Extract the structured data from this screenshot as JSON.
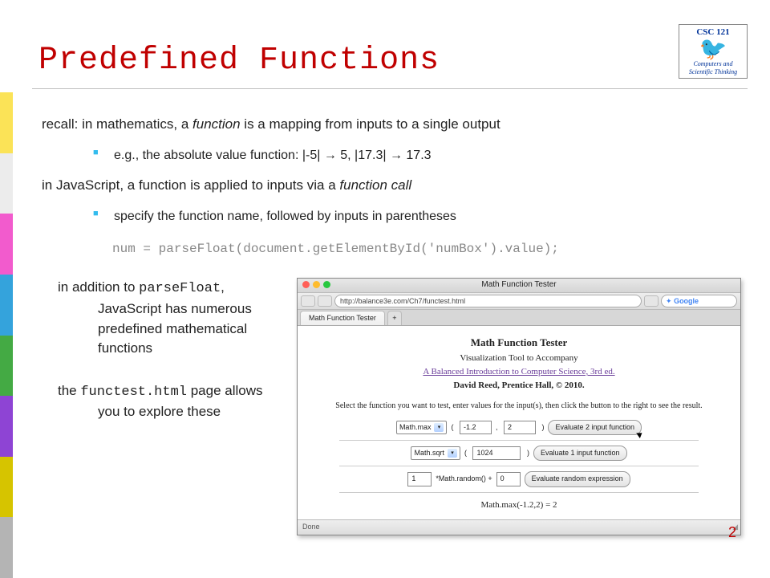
{
  "course": {
    "code": "CSC 121",
    "subtitle": "Computers and Scientific Thinking"
  },
  "title": "Predefined Functions",
  "stripes": [
    "#fbe357",
    "#ececec",
    "#f25bcd",
    "#34a3dc",
    "#44aa44",
    "#8e44d4",
    "#d6c400",
    "#b4b4b4"
  ],
  "body": {
    "p1_pre": "recall: in mathematics, a ",
    "p1_em": "function",
    "p1_post": " is a mapping from inputs to a single output",
    "b1": "e.g., the absolute value function:    |-5| → 5,     |17.3| → 17.3",
    "p2_pre": "in JavaScript, a function is applied to inputs via a ",
    "p2_em": "function call",
    "b2": "specify the function name, followed by inputs in parentheses",
    "code": "num = parseFloat(document.getElementById('numBox').value);",
    "p3_pre": "in addition to ",
    "p3_code": "parseFloat",
    "p3_post": ", JavaScript has numerous predefined mathematical functions",
    "p4_pre": "the ",
    "p4_code": "functest.html",
    "p4_post": " page allows you to explore these"
  },
  "browser": {
    "windowTitle": "Math Function Tester",
    "url": "http://balance3e.com/Ch7/functest.html",
    "searchPlaceholder": "Google",
    "tabLabel": "Math Function Tester",
    "page": {
      "h": "Math Function Tester",
      "sub1": "Visualization Tool to Accompany",
      "sub2": "A Balanced Introduction to Computer Science, 3rd ed.",
      "sub3": "David Reed, Prentice Hall, © 2010.",
      "instr": "Select the function you want to test, enter values for the input(s), then click the button to the right to see the result.",
      "row1": {
        "fn": "Math.max",
        "a": "-1.2",
        "b": "2",
        "btn": "Evaluate 2 input function"
      },
      "row2": {
        "fn": "Math.sqrt",
        "a": "1024",
        "btn": "Evaluate 1 input function"
      },
      "row3": {
        "a": "1",
        "mid": "*Math.random() +",
        "b": "0",
        "btn": "Evaluate random expression"
      },
      "result": "Math.max(-1.2,2) = 2"
    },
    "status": "Done"
  },
  "pageNumber": "2"
}
